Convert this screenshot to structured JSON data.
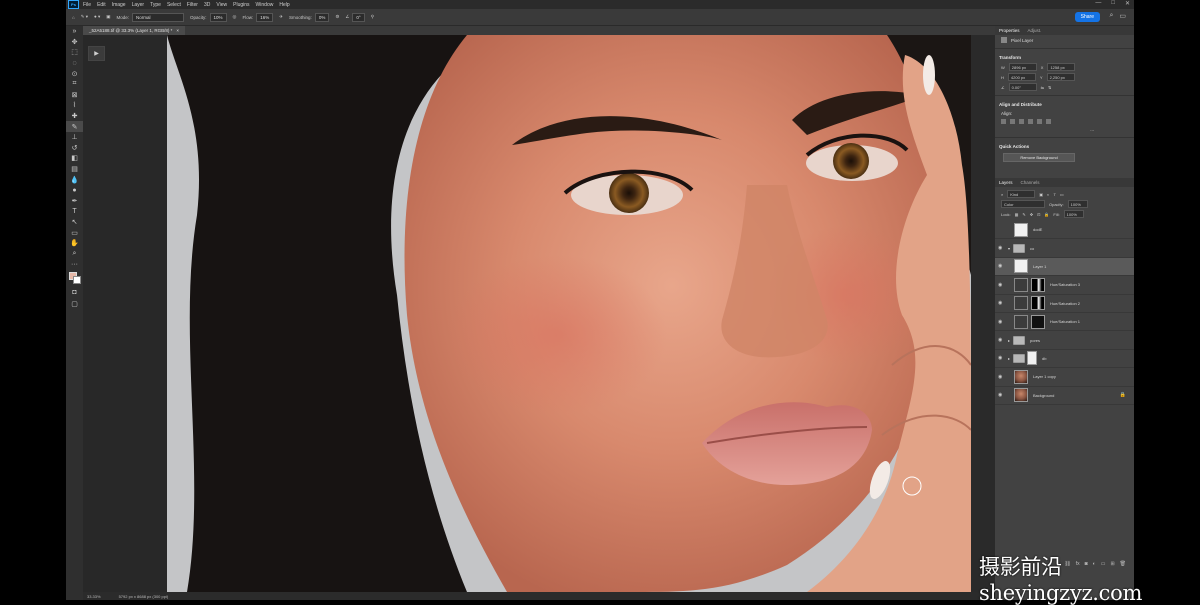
{
  "menu": {
    "app_icon": "Ps",
    "items": [
      "File",
      "Edit",
      "Image",
      "Layer",
      "Type",
      "Select",
      "Filter",
      "3D",
      "View",
      "Plugins",
      "Window",
      "Help"
    ],
    "window_controls": [
      "—",
      "□",
      "✕"
    ]
  },
  "options": {
    "mode_label": "Mode:",
    "mode_value": "Normal",
    "opacity_label": "Opacity:",
    "opacity_value": "10%",
    "flow_label": "Flow:",
    "flow_value": "16%",
    "smoothing_label": "Smoothing:",
    "smoothing_value": "0%",
    "angle_value": "0°",
    "share_label": "Share"
  },
  "document": {
    "tab_title": "_52A5188.tif @ 33.3% (Layer 1, RGB/8) *",
    "close_glyph": "×"
  },
  "status": {
    "zoom": "33.33%",
    "doc_info": "5792 px x 8688 px (300 ppi)"
  },
  "properties": {
    "tabs": [
      "Properties",
      "Adjust."
    ],
    "kind_label": "Pixel Layer",
    "transform": {
      "title": "Transform",
      "w": "2896 px",
      "h": "4200 px",
      "x": "1258 px",
      "y": "2,250 px",
      "angle": "0.00°"
    },
    "align": {
      "title": "Align and Distribute",
      "sub": "Align:",
      "more": "..."
    },
    "quick": {
      "title": "Quick Actions",
      "button": "Remove Background"
    }
  },
  "layers_panel": {
    "tabs": [
      "Layers",
      "Channels"
    ],
    "kind_filter": "Kind",
    "blend_mode": "Color",
    "opacity_label": "Opacity:",
    "opacity_value": "100%",
    "lock_label": "Lock:",
    "fill_label": "Fill:",
    "fill_value": "100%",
    "layers": [
      {
        "name": "dodE",
        "type": "pixel",
        "visible": false
      },
      {
        "name": "co",
        "type": "group",
        "visible": true
      },
      {
        "name": "Layer 1",
        "type": "pixel",
        "visible": true,
        "selected": true
      },
      {
        "name": "Hue/Saturation 3",
        "type": "adjustment",
        "visible": true
      },
      {
        "name": "Hue/Saturation 2",
        "type": "adjustment",
        "visible": true
      },
      {
        "name": "Hue/Saturation 1",
        "type": "adjustment",
        "visible": true
      },
      {
        "name": "pores",
        "type": "group",
        "visible": true
      },
      {
        "name": "db",
        "type": "group",
        "visible": true
      },
      {
        "name": "Layer 1 copy",
        "type": "photo",
        "visible": true
      },
      {
        "name": "Background",
        "type": "photo",
        "visible": true,
        "locked": true
      }
    ],
    "footer_icons": [
      "link-icon",
      "fx-icon",
      "mask-icon",
      "adjustment-icon",
      "folder-icon",
      "new-layer-icon",
      "trash-icon"
    ]
  },
  "watermark": "摄影前沿 sheyingzyz.com"
}
